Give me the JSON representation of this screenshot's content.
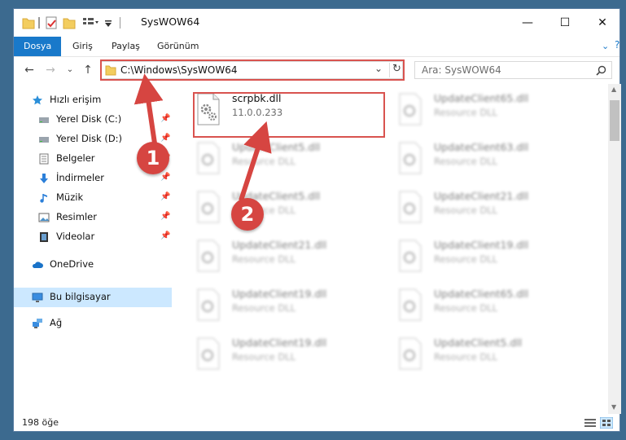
{
  "window": {
    "title": "SysWOW64",
    "minimize_glyph": "—",
    "maximize_glyph": "☐",
    "close_glyph": "✕"
  },
  "ribbon": {
    "tabs": [
      "Dosya",
      "Giriş",
      "Paylaş",
      "Görünüm"
    ],
    "active_tab": "Dosya"
  },
  "nav": {
    "address": "C:\\Windows\\SysWOW64",
    "search_placeholder": "Ara: SysWOW64"
  },
  "sidebar": {
    "items": [
      {
        "label": "Hızlı erişim",
        "icon": "star-icon"
      },
      {
        "label": "Yerel Disk (C:)",
        "icon": "drive-icon",
        "pinned": true
      },
      {
        "label": "Yerel Disk (D:)",
        "icon": "drive-icon",
        "pinned": true
      },
      {
        "label": "Belgeler",
        "icon": "documents-icon",
        "pinned": true
      },
      {
        "label": "İndirmeler",
        "icon": "download-icon",
        "pinned": true
      },
      {
        "label": "Müzik",
        "icon": "music-icon",
        "pinned": true
      },
      {
        "label": "Resimler",
        "icon": "pictures-icon",
        "pinned": true
      },
      {
        "label": "Videolar",
        "icon": "videos-icon",
        "pinned": true
      },
      {
        "label": "OneDrive",
        "icon": "cloud-icon"
      },
      {
        "label": "Bu bilgisayar",
        "icon": "computer-icon",
        "selected": true
      },
      {
        "label": "Ağ",
        "icon": "network-icon"
      }
    ]
  },
  "files": [
    {
      "name": "scrpbk.dll",
      "detail": "11.0.0.233",
      "highlighted": true
    },
    {
      "name": "UpdateClient65.dll",
      "detail": "Resource DLL"
    },
    {
      "name": "UpdateClient5.dll",
      "detail": "Resource DLL"
    },
    {
      "name": "UpdateClient63.dll",
      "detail": "Resource DLL"
    },
    {
      "name": "UpdateClient5.dll",
      "detail": "Resource DLL"
    },
    {
      "name": "UpdateClient21.dll",
      "detail": "Resource DLL"
    },
    {
      "name": "UpdateClient21.dll",
      "detail": "Resource DLL"
    },
    {
      "name": "UpdateClient19.dll",
      "detail": "Resource DLL"
    },
    {
      "name": "UpdateClient19.dll",
      "detail": "Resource DLL"
    },
    {
      "name": "UpdateClient65.dll",
      "detail": "Resource DLL"
    },
    {
      "name": "UpdateClient19.dll",
      "detail": "Resource DLL"
    },
    {
      "name": "UpdateClient5.dll",
      "detail": "Resource DLL"
    }
  ],
  "status": {
    "item_count": "198 öğe"
  },
  "callouts": [
    "1",
    "2"
  ],
  "colors": {
    "accent": "#1979ca",
    "annotation_red": "#d64541",
    "selected_bg": "#cce8ff"
  }
}
